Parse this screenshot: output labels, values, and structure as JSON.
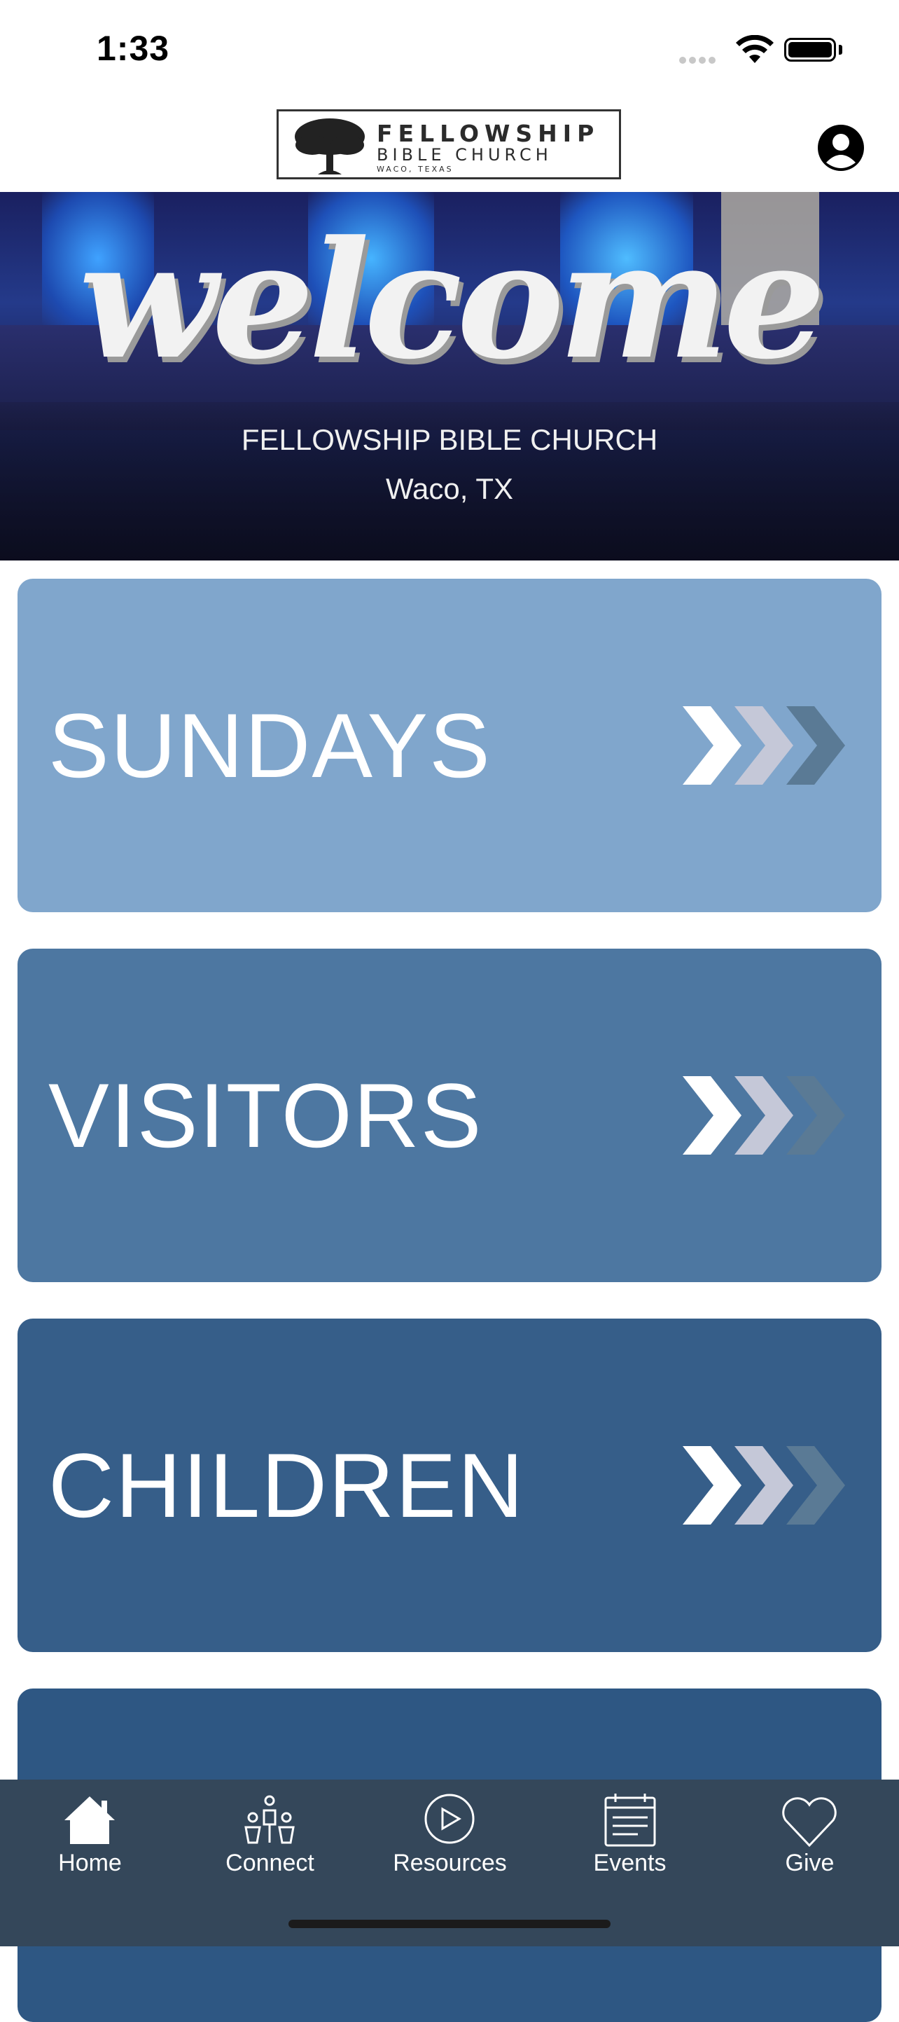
{
  "status_bar": {
    "time": "1:33"
  },
  "header": {
    "logo_line1": "FELLOWSHIP",
    "logo_line2": "BIBLE CHURCH",
    "logo_line3": "WACO, TEXAS",
    "profile_icon": "user-circle-icon"
  },
  "hero": {
    "title": "welcome",
    "church": "FELLOWSHIP BIBLE CHURCH",
    "city": "Waco, TX"
  },
  "cards": [
    {
      "label": "SUNDAYS",
      "color": "#80a6cc"
    },
    {
      "label": "VISITORS",
      "color": "#4d77a1"
    },
    {
      "label": "CHILDREN",
      "color": "#365e89"
    },
    {
      "label": "",
      "color": "#2e5783"
    }
  ],
  "arrow_colors": [
    "#ffffff",
    "#c5c8d8",
    "#5a7a95"
  ],
  "tabbar": {
    "background": "#34475a",
    "tabs": [
      {
        "label": "Home",
        "icon": "home-icon"
      },
      {
        "label": "Connect",
        "icon": "people-icon"
      },
      {
        "label": "Resources",
        "icon": "play-circle-icon"
      },
      {
        "label": "Events",
        "icon": "calendar-icon"
      },
      {
        "label": "Give",
        "icon": "heart-icon"
      }
    ]
  }
}
